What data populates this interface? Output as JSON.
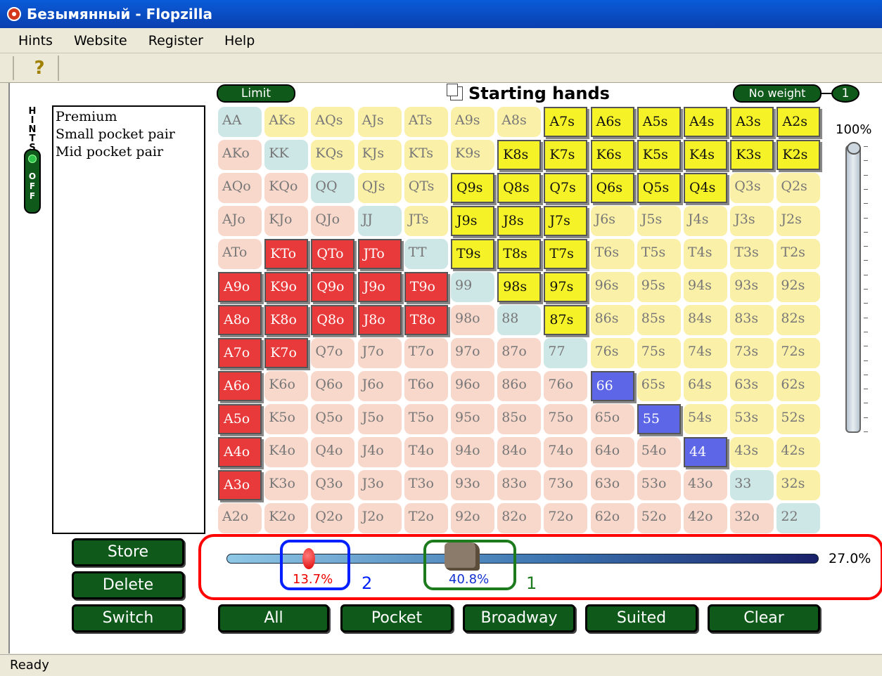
{
  "window": {
    "title": "Безымянный - Flopzilla"
  },
  "menu": {
    "items": [
      "Hints",
      "Website",
      "Register",
      "Help"
    ]
  },
  "toolbar": {
    "help_icon": "help-icon",
    "help_label": "?"
  },
  "hints": {
    "vertical_label": [
      "H",
      "I",
      "N",
      "T",
      "S"
    ],
    "toggle_label": [
      "O",
      "F",
      "F"
    ],
    "list": [
      "Premium",
      "Small pocket pair",
      "Mid pocket pair"
    ]
  },
  "header": {
    "limit_label": "Limit",
    "title": "Starting hands",
    "weight_label": "No weight",
    "weight_badge": "1"
  },
  "grid": {
    "rows": [
      [
        "AA",
        "AKs",
        "AQs",
        "AJs",
        "ATs",
        "A9s",
        "A8s",
        "A7s",
        "A6s",
        "A5s",
        "A4s",
        "A3s",
        "A2s"
      ],
      [
        "AKo",
        "KK",
        "KQs",
        "KJs",
        "KTs",
        "K9s",
        "K8s",
        "K7s",
        "K6s",
        "K5s",
        "K4s",
        "K3s",
        "K2s"
      ],
      [
        "AQo",
        "KQo",
        "QQ",
        "QJs",
        "QTs",
        "Q9s",
        "Q8s",
        "Q7s",
        "Q6s",
        "Q5s",
        "Q4s",
        "Q3s",
        "Q2s"
      ],
      [
        "AJo",
        "KJo",
        "QJo",
        "JJ",
        "JTs",
        "J9s",
        "J8s",
        "J7s",
        "J6s",
        "J5s",
        "J4s",
        "J3s",
        "J2s"
      ],
      [
        "ATo",
        "KTo",
        "QTo",
        "JTo",
        "TT",
        "T9s",
        "T8s",
        "T7s",
        "T6s",
        "T5s",
        "T4s",
        "T3s",
        "T2s"
      ],
      [
        "A9o",
        "K9o",
        "Q9o",
        "J9o",
        "T9o",
        "99",
        "98s",
        "97s",
        "96s",
        "95s",
        "94s",
        "93s",
        "92s"
      ],
      [
        "A8o",
        "K8o",
        "Q8o",
        "J8o",
        "T8o",
        "98o",
        "88",
        "87s",
        "86s",
        "85s",
        "84s",
        "83s",
        "82s"
      ],
      [
        "A7o",
        "K7o",
        "Q7o",
        "J7o",
        "T7o",
        "97o",
        "87o",
        "77",
        "76s",
        "75s",
        "74s",
        "73s",
        "72s"
      ],
      [
        "A6o",
        "K6o",
        "Q6o",
        "J6o",
        "T6o",
        "96o",
        "86o",
        "76o",
        "66",
        "65s",
        "64s",
        "63s",
        "62s"
      ],
      [
        "A5o",
        "K5o",
        "Q5o",
        "J5o",
        "T5o",
        "95o",
        "85o",
        "75o",
        "65o",
        "55",
        "54s",
        "53s",
        "52s"
      ],
      [
        "A4o",
        "K4o",
        "Q4o",
        "J4o",
        "T4o",
        "94o",
        "84o",
        "74o",
        "64o",
        "54o",
        "44",
        "43s",
        "42s"
      ],
      [
        "A3o",
        "K3o",
        "Q3o",
        "J3o",
        "T3o",
        "93o",
        "83o",
        "73o",
        "63o",
        "53o",
        "43o",
        "33",
        "32s"
      ],
      [
        "A2o",
        "K2o",
        "Q2o",
        "J2o",
        "T2o",
        "92o",
        "82o",
        "72o",
        "62o",
        "52o",
        "42o",
        "32o",
        "22"
      ]
    ],
    "selected_yellow": [
      "A7s",
      "A6s",
      "A5s",
      "A4s",
      "A3s",
      "A2s",
      "K8s",
      "K7s",
      "K6s",
      "K5s",
      "K4s",
      "K3s",
      "K2s",
      "Q9s",
      "Q8s",
      "Q7s",
      "Q6s",
      "Q5s",
      "Q4s",
      "J9s",
      "J8s",
      "J7s",
      "T9s",
      "T8s",
      "T7s",
      "98s",
      "97s",
      "87s"
    ],
    "selected_red": [
      "KTo",
      "QTo",
      "JTo",
      "A9o",
      "K9o",
      "Q9o",
      "J9o",
      "T9o",
      "A8o",
      "K8o",
      "Q8o",
      "J8o",
      "T8o",
      "A7o",
      "K7o",
      "A6o",
      "A5o",
      "A4o",
      "A3o"
    ],
    "selected_blue": [
      "66",
      "55",
      "44"
    ]
  },
  "weight_slider": {
    "label": "100%",
    "value_fraction": 1.0
  },
  "range_slider": {
    "red_value": "13.7%",
    "red_fraction": 0.137,
    "gray_value": "40.8%",
    "gray_fraction": 0.408,
    "total": "27.0%",
    "annotation_blue": "2",
    "annotation_green": "1"
  },
  "buttons": {
    "store": "Store",
    "delete": "Delete",
    "switch": "Switch",
    "all": "All",
    "pocket": "Pocket",
    "broadway": "Broadway",
    "suited": "Suited",
    "clear": "Clear"
  },
  "status": {
    "text": "Ready"
  }
}
